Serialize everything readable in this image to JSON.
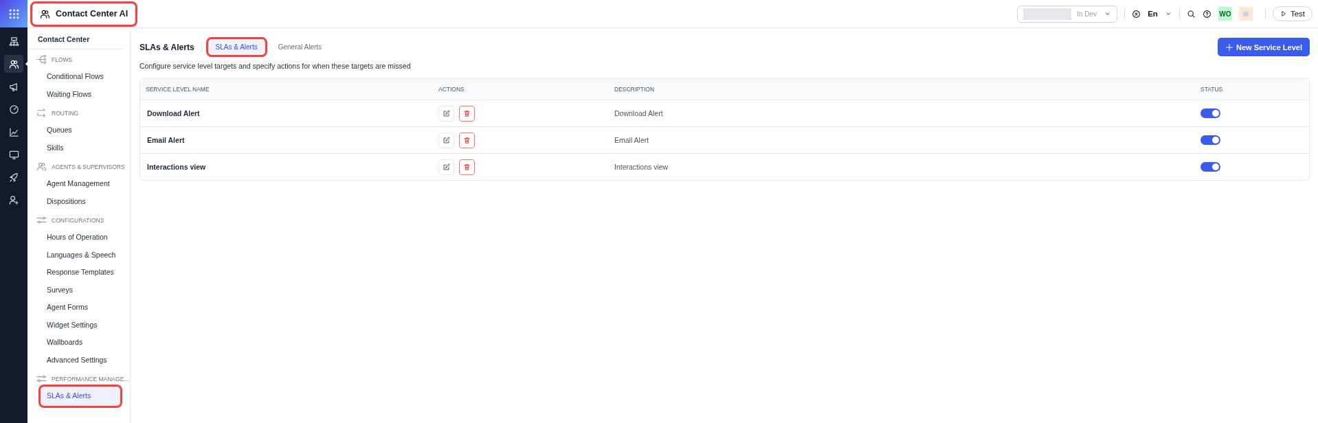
{
  "app": {
    "title": "Contact Center AI",
    "highlighted": true
  },
  "rail": [
    {
      "kind": "hierarchy",
      "selected": false
    },
    {
      "kind": "people",
      "selected": true
    },
    {
      "kind": "megaphone",
      "selected": false
    },
    {
      "kind": "gauge",
      "selected": false
    },
    {
      "kind": "chart",
      "selected": false
    },
    {
      "kind": "monitor",
      "selected": false
    },
    {
      "kind": "rocket",
      "selected": false
    },
    {
      "kind": "user-plus",
      "selected": false
    }
  ],
  "topbar": {
    "environment": "In Dev",
    "language": "En",
    "avatar": "WO",
    "test_button": "Test"
  },
  "sidebar": {
    "title": "Contact Center",
    "sections": [
      {
        "label": "FLOWS",
        "kind": "flow",
        "items": [
          {
            "label": "Conditional Flows",
            "selected": false,
            "highlighted": false
          },
          {
            "label": "Waiting Flows",
            "selected": false,
            "highlighted": false
          }
        ]
      },
      {
        "label": "ROUTING",
        "kind": "routing",
        "items": [
          {
            "label": "Queues",
            "selected": false,
            "highlighted": false
          },
          {
            "label": "Skills",
            "selected": false,
            "highlighted": false
          }
        ]
      },
      {
        "label": "AGENTS & SUPERVISORS",
        "kind": "people",
        "items": [
          {
            "label": "Agent Management",
            "selected": false,
            "highlighted": false
          },
          {
            "label": "Dispositions",
            "selected": false,
            "highlighted": false
          }
        ]
      },
      {
        "label": "CONFIGURATIONS",
        "kind": "sliders",
        "items": [
          {
            "label": "Hours of Operation",
            "selected": false,
            "highlighted": false
          },
          {
            "label": "Languages & Speech",
            "selected": false,
            "highlighted": false
          },
          {
            "label": "Response Templates",
            "selected": false,
            "highlighted": false
          },
          {
            "label": "Surveys",
            "selected": false,
            "highlighted": false
          },
          {
            "label": "Agent Forms",
            "selected": false,
            "highlighted": false
          },
          {
            "label": "Widget Settings",
            "selected": false,
            "highlighted": false
          },
          {
            "label": "Wallboards",
            "selected": false,
            "highlighted": false
          },
          {
            "label": "Advanced Settings",
            "selected": false,
            "highlighted": false
          }
        ]
      },
      {
        "label": "PERFORMANCE MANAGE...",
        "kind": "sliders",
        "items": [
          {
            "label": "SLAs & Alerts",
            "selected": true,
            "highlighted": true
          }
        ]
      }
    ]
  },
  "page": {
    "title": "SLAs & Alerts",
    "tabs": [
      {
        "label": "SLAs & Alerts",
        "selected": true,
        "highlighted": true
      },
      {
        "label": "General Alerts",
        "selected": false,
        "highlighted": false
      }
    ],
    "description": "Configure service level targets and specify actions for when these targets are missed",
    "new_button": "New Service Level",
    "table": {
      "columns": [
        "SERVICE LEVEL NAME",
        "ACTIONS",
        "DESCRIPTION",
        "STATUS"
      ],
      "rows": [
        {
          "name": "Download Alert",
          "description": "Download Alert",
          "enabled": true
        },
        {
          "name": "Email Alert",
          "description": "Email Alert",
          "enabled": true
        },
        {
          "name": "Interactions view",
          "description": "Interactions view",
          "enabled": true
        }
      ]
    }
  }
}
